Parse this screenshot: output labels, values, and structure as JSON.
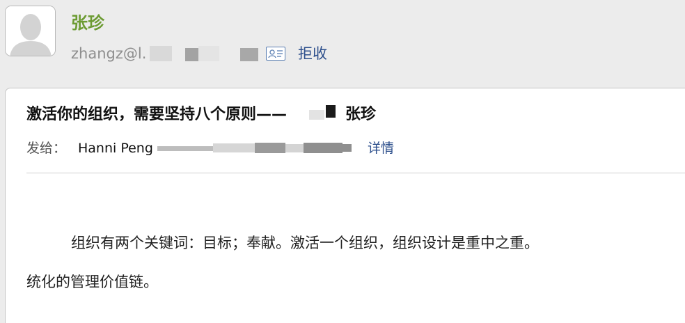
{
  "sender": {
    "name": "张珍",
    "email_visible": "zhangz@l.",
    "reject_label": "拒收"
  },
  "message": {
    "subject": "激活你的组织，需要坚持八个原则——",
    "subject_suffix": "张珍",
    "recipient_label": "发给：",
    "recipient_name": "Hanni Peng",
    "details_label": "详情"
  },
  "body": {
    "paragraph_1": "组织有两个关键词：目标；奉献。激活一个组织，组织设计是重中之重。",
    "paragraph_2": "统化的管理价值链。"
  },
  "colors": {
    "sender_name": "#6c9b32",
    "link": "#2d4f8c",
    "background": "#ececec",
    "card": "#ffffff"
  },
  "icons": {
    "avatar": "person-silhouette-icon",
    "vcard": "vcard-icon"
  }
}
